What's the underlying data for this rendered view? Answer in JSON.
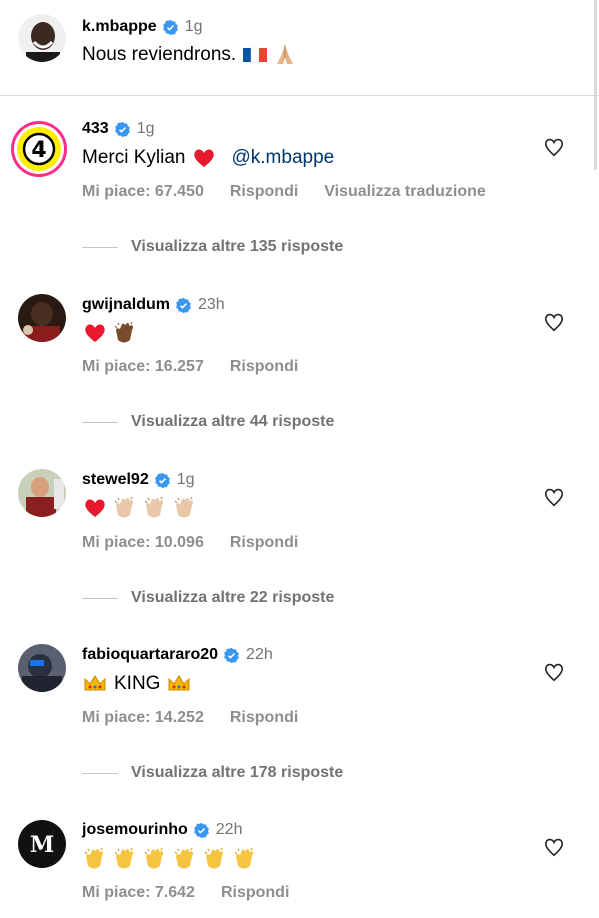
{
  "caption": {
    "username": "k.mbappe",
    "time": "1g",
    "text": "Nous reviendrons.",
    "emojis": [
      "france-flag",
      "folded-hands"
    ]
  },
  "comments": [
    {
      "username": "433",
      "time": "1g",
      "text": "Merci Kylian",
      "emojis_after_text": [
        "red-heart"
      ],
      "mention": "@k.mbappe",
      "likes": "Mi piace: 67.450",
      "reply": "Rispondi",
      "translate": "Visualizza traduzione",
      "more_replies": "Visualizza altre 135 risposte",
      "avatar_badge": "4"
    },
    {
      "username": "gwijnaldum",
      "time": "23h",
      "emojis": [
        "red-heart",
        "clapping-hands-dark"
      ],
      "likes": "Mi piace: 16.257",
      "reply": "Rispondi",
      "more_replies": "Visualizza altre 44 risposte"
    },
    {
      "username": "stewel92",
      "time": "1g",
      "emojis": [
        "red-heart",
        "clapping-hands-light",
        "clapping-hands-light",
        "clapping-hands-light"
      ],
      "likes": "Mi piace: 10.096",
      "reply": "Rispondi",
      "more_replies": "Visualizza altre 22 risposte"
    },
    {
      "username": "fabioquartararo20",
      "time": "22h",
      "text": "KING",
      "emojis_before_text": [
        "crown"
      ],
      "emojis_after_text": [
        "crown"
      ],
      "likes": "Mi piace: 14.252",
      "reply": "Rispondi",
      "more_replies": "Visualizza altre 178 risposte"
    },
    {
      "username": "josemourinho",
      "time": "22h",
      "emojis": [
        "clapping-hands-yellow",
        "clapping-hands-yellow",
        "clapping-hands-yellow",
        "clapping-hands-yellow",
        "clapping-hands-yellow",
        "clapping-hands-yellow"
      ],
      "likes": "Mi piace: 7.642",
      "reply": "Rispondi",
      "avatar_letters": "M"
    }
  ],
  "colors": {
    "verified": "#3897f0",
    "mention": "#00376b",
    "meta": "#8e8e8e",
    "heart": "#e0245e"
  }
}
